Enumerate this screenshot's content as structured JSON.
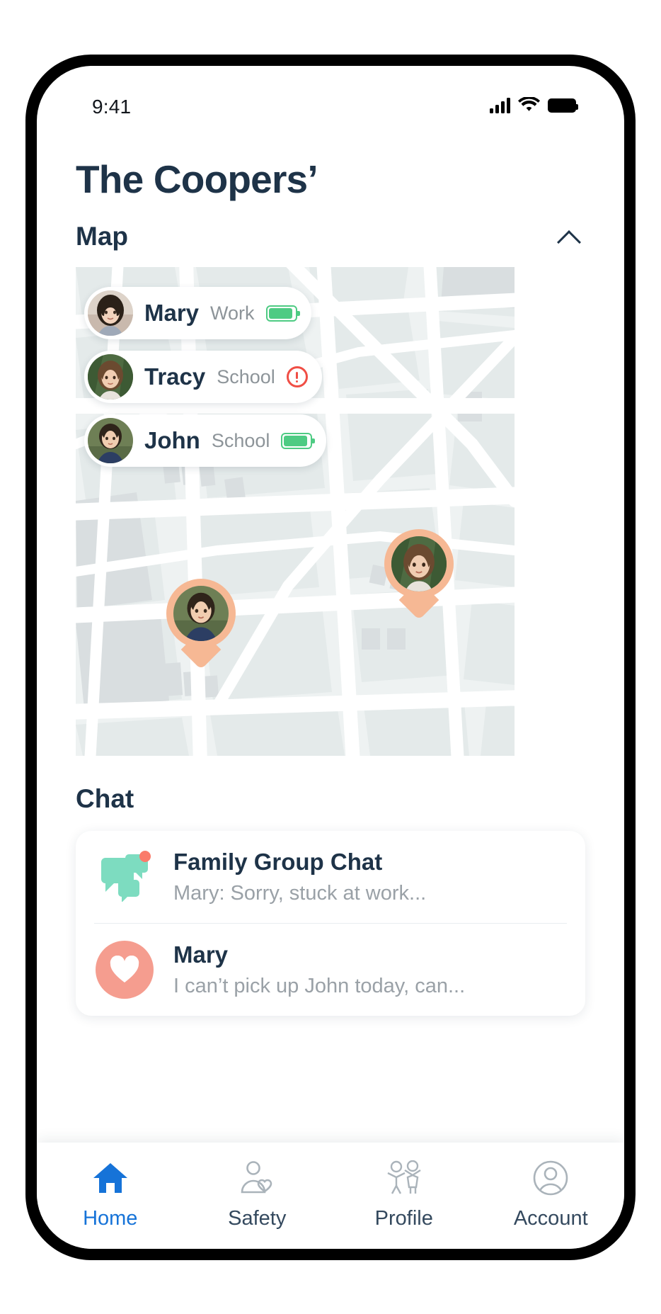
{
  "status_bar": {
    "time": "9:41",
    "signal_icon": "cellular-signal-icon",
    "wifi_icon": "wifi-icon",
    "battery_icon": "battery-icon"
  },
  "header": {
    "title": "The Coopers’"
  },
  "map_section": {
    "title": "Map",
    "collapse_icon": "chevron-up-icon",
    "members": [
      {
        "name": "Mary",
        "place": "Work",
        "status_type": "battery",
        "battery_color": "#4ecb83"
      },
      {
        "name": "Tracy",
        "place": "School",
        "status_type": "alert",
        "alert_color": "#f04e45"
      },
      {
        "name": "John",
        "place": "School",
        "status_type": "battery",
        "battery_color": "#4ecb83"
      }
    ],
    "pins": [
      {
        "label": "john-map-pin",
        "pin_color": "#f6b894"
      },
      {
        "label": "tracy-map-pin",
        "pin_color": "#f6b894"
      }
    ],
    "map_colors": {
      "land": "#eef2f2",
      "block": "#e4eaea",
      "building": "#d9dee0",
      "road": "#ffffff"
    }
  },
  "chat_section": {
    "title": "Chat",
    "items": [
      {
        "title": "Family Group Chat",
        "preview": "Mary: Sorry, stuck at work...",
        "icon": "chat-bubbles-icon",
        "icon_color": "#7ddcc0",
        "has_notification": true,
        "notification_color": "#fa7b6b"
      },
      {
        "title": "Mary",
        "preview": "I can’t pick up John today, can...",
        "icon": "heart-icon",
        "icon_color": "#f59d8f",
        "has_notification": false
      }
    ]
  },
  "bottom_nav": {
    "active_color": "#1673d8",
    "inactive_color": "#34495e",
    "items": [
      {
        "label": "Home",
        "icon": "home-icon",
        "active": true
      },
      {
        "label": "Safety",
        "icon": "person-heart-icon",
        "active": false
      },
      {
        "label": "Profile",
        "icon": "family-people-icon",
        "active": false
      },
      {
        "label": "Account",
        "icon": "user-circle-icon",
        "active": false
      }
    ]
  }
}
